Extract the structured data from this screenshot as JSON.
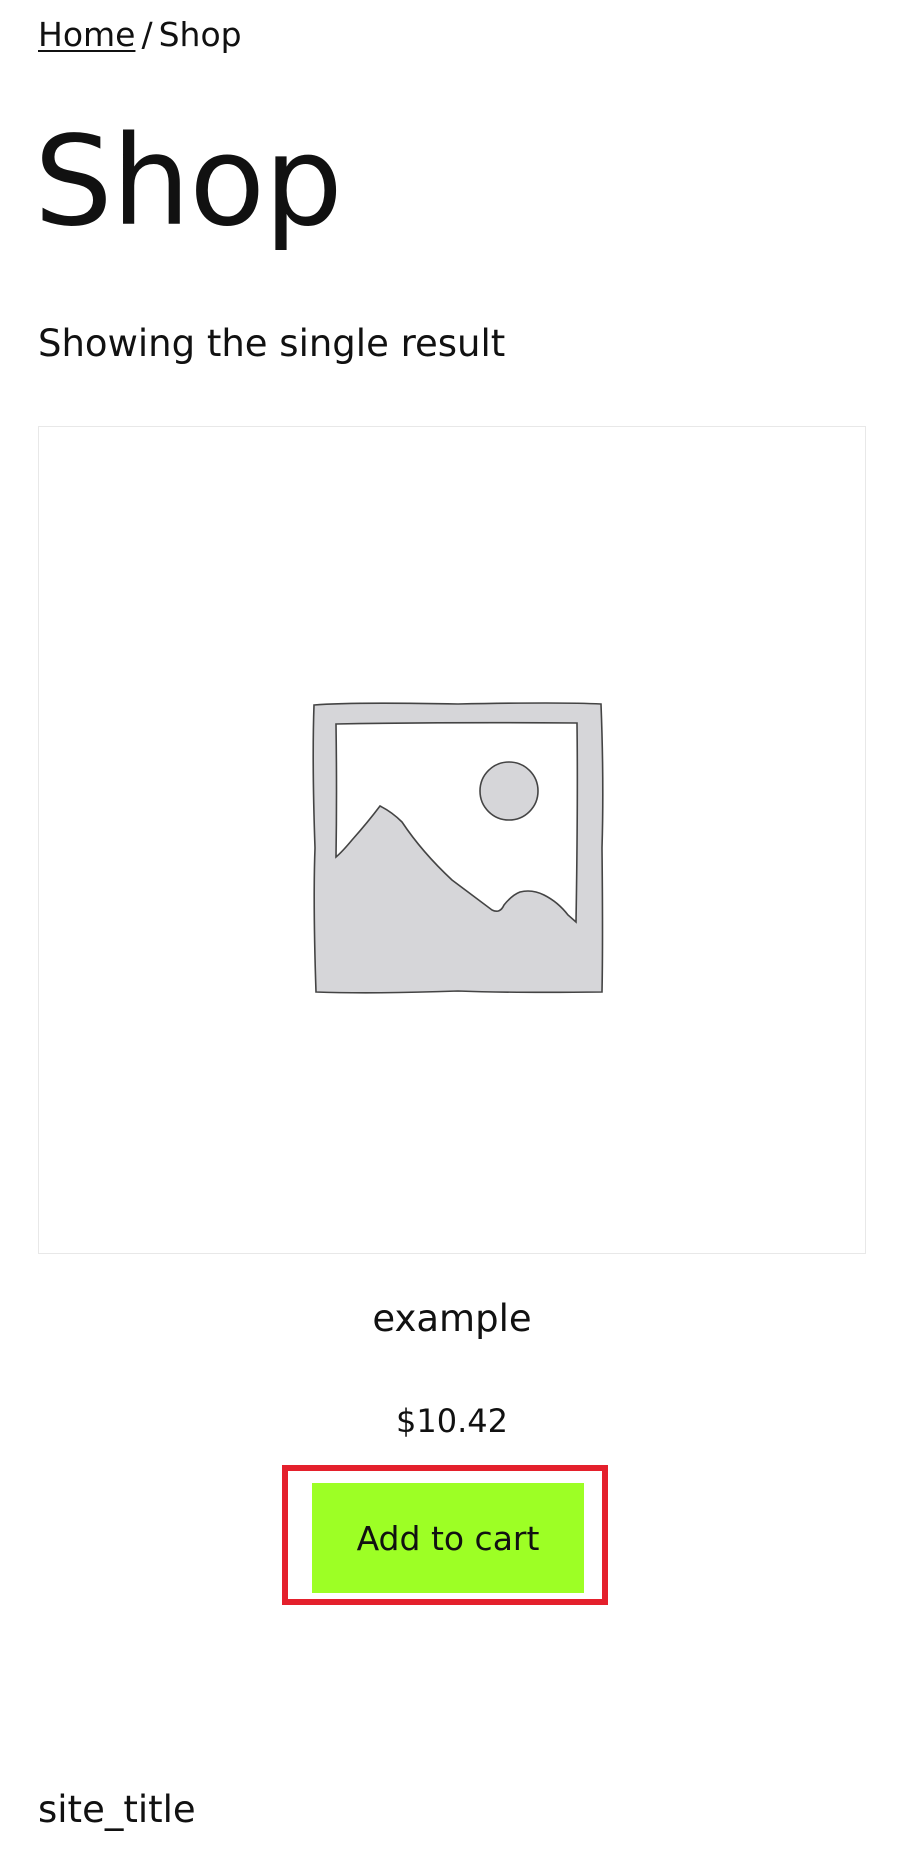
{
  "breadcrumb": {
    "home_label": "Home",
    "separator": "/",
    "current_label": "Shop"
  },
  "page": {
    "title": "Shop",
    "result_count": "Showing the single result"
  },
  "product": {
    "name": "example",
    "price": "$10.42",
    "add_to_cart_label": "Add to cart",
    "image_icon": "image-placeholder-icon"
  },
  "footer": {
    "site_title": "site_title"
  },
  "colors": {
    "button_background": "#9dff25",
    "highlight_border": "#e4202c",
    "text": "#111111"
  }
}
